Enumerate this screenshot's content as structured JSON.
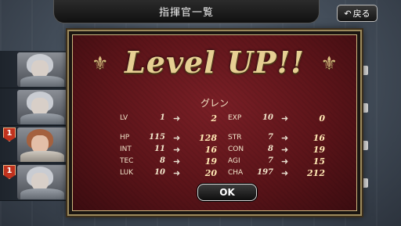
{
  "header": {
    "title": "指揮官一覧",
    "back_label": "戻る"
  },
  "list": {
    "badges": [
      "1",
      "1"
    ]
  },
  "modal": {
    "title": "Level UP!!",
    "character_name": "グレン",
    "ok_label": "OK",
    "stats_left": [
      {
        "label": "LV",
        "from": "1",
        "to": "2"
      },
      {
        "label": "HP",
        "from": "115",
        "to": "128"
      },
      {
        "label": "INT",
        "from": "11",
        "to": "16"
      },
      {
        "label": "TEC",
        "from": "8",
        "to": "19"
      },
      {
        "label": "LUK",
        "from": "10",
        "to": "20"
      }
    ],
    "stats_right": [
      {
        "label": "EXP",
        "from": "10",
        "to": "0"
      },
      {
        "label": "STR",
        "from": "7",
        "to": "16"
      },
      {
        "label": "CON",
        "from": "8",
        "to": "19"
      },
      {
        "label": "AGI",
        "from": "7",
        "to": "15"
      },
      {
        "label": "CHA",
        "from": "197",
        "to": "212"
      }
    ]
  },
  "colors": {
    "modal_bg": "#6a1a20",
    "gold": "#e6cf93"
  },
  "icons": {
    "back": "return-arrow-icon",
    "arrow": "right-arrow-icon",
    "flourish": "ornament-icon"
  }
}
